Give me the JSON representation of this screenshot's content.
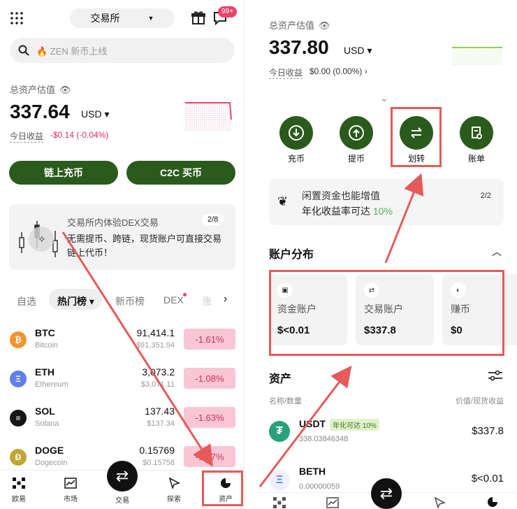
{
  "colors": {
    "accent": "#2a5a1c",
    "negative": "#d32f5a",
    "negative_bg": "#f8c6d5",
    "annotation": "#e65a5a"
  },
  "left": {
    "header": {
      "menu_icon": "grid-icon",
      "mode_label": "交易所",
      "gift_icon": "gift-icon",
      "msg_icon": "message-icon",
      "msg_badge": "99+"
    },
    "search": {
      "placeholder": "🔥 ZEN 新币上线"
    },
    "balance": {
      "title": "总资产估值",
      "value": "337.64",
      "unit": "USD",
      "pnl_label": "今日收益",
      "pnl_value": "-$0.14 (-0.04%)"
    },
    "buttons": {
      "onchain": "链上充币",
      "c2c": "C2C 买币"
    },
    "promo": {
      "text": "交易所内体验DEX交易",
      "subtext": "无需提币、跨链，现货账户可直接交易链上代币！",
      "page": "2/8"
    },
    "tabs": [
      "自选",
      "热门榜",
      "新币榜",
      "DEX",
      "涨"
    ],
    "coins": [
      {
        "sym": "BTC",
        "name": "Bitcoin",
        "price": "91,414.1",
        "fiat": "$91,351.94",
        "chg": "-1.61%",
        "color": "#f2952a",
        "glyph": "₿"
      },
      {
        "sym": "ETH",
        "name": "Ethereum",
        "price": "3,073.2",
        "fiat": "$3,071.11",
        "chg": "-1.08%",
        "color": "#627eea",
        "glyph": "Ξ"
      },
      {
        "sym": "SOL",
        "name": "Solana",
        "price": "137.43",
        "fiat": "$137.34",
        "chg": "-1.63%",
        "color": "#151515",
        "glyph": "≡"
      },
      {
        "sym": "DOGE",
        "name": "Dogecoin",
        "price": "0.15769",
        "fiat": "$0.15758",
        "chg": "-1.77%",
        "color": "#c2a633",
        "glyph": "Ð"
      }
    ],
    "nav": [
      "欧易",
      "市场",
      "交易",
      "探索",
      "资产"
    ]
  },
  "right": {
    "balance": {
      "title": "总资产估值",
      "value": "337.80",
      "unit": "USD",
      "pnl_label": "今日收益",
      "pnl_value": "$0.00 (0.00%)"
    },
    "actions": [
      "充币",
      "提币",
      "划转",
      "账单"
    ],
    "banner": {
      "line1": "闲置资金也能增值",
      "line2_prefix": "年化收益率可达",
      "line2_value": "10%",
      "page": "2/2"
    },
    "accounts_title": "账户分布",
    "accounts": [
      {
        "label": "资金账户",
        "value": "$<0.01",
        "icon": "wallet-icon"
      },
      {
        "label": "交易账户",
        "value": "$337.8",
        "icon": "swap-icon"
      },
      {
        "label": "赚币",
        "value": "$0",
        "icon": "piggy-icon"
      }
    ],
    "assets_title": "资产",
    "asset_cols": {
      "left": "名称/数量",
      "right": "价值/现货收益"
    },
    "assets": [
      {
        "sym": "USDT",
        "tag": "年化可达 10%",
        "amount": "338.03846348",
        "value": "$337.8"
      },
      {
        "sym": "BETH",
        "amount": "0.00000059",
        "value": "$<0.01"
      }
    ]
  }
}
